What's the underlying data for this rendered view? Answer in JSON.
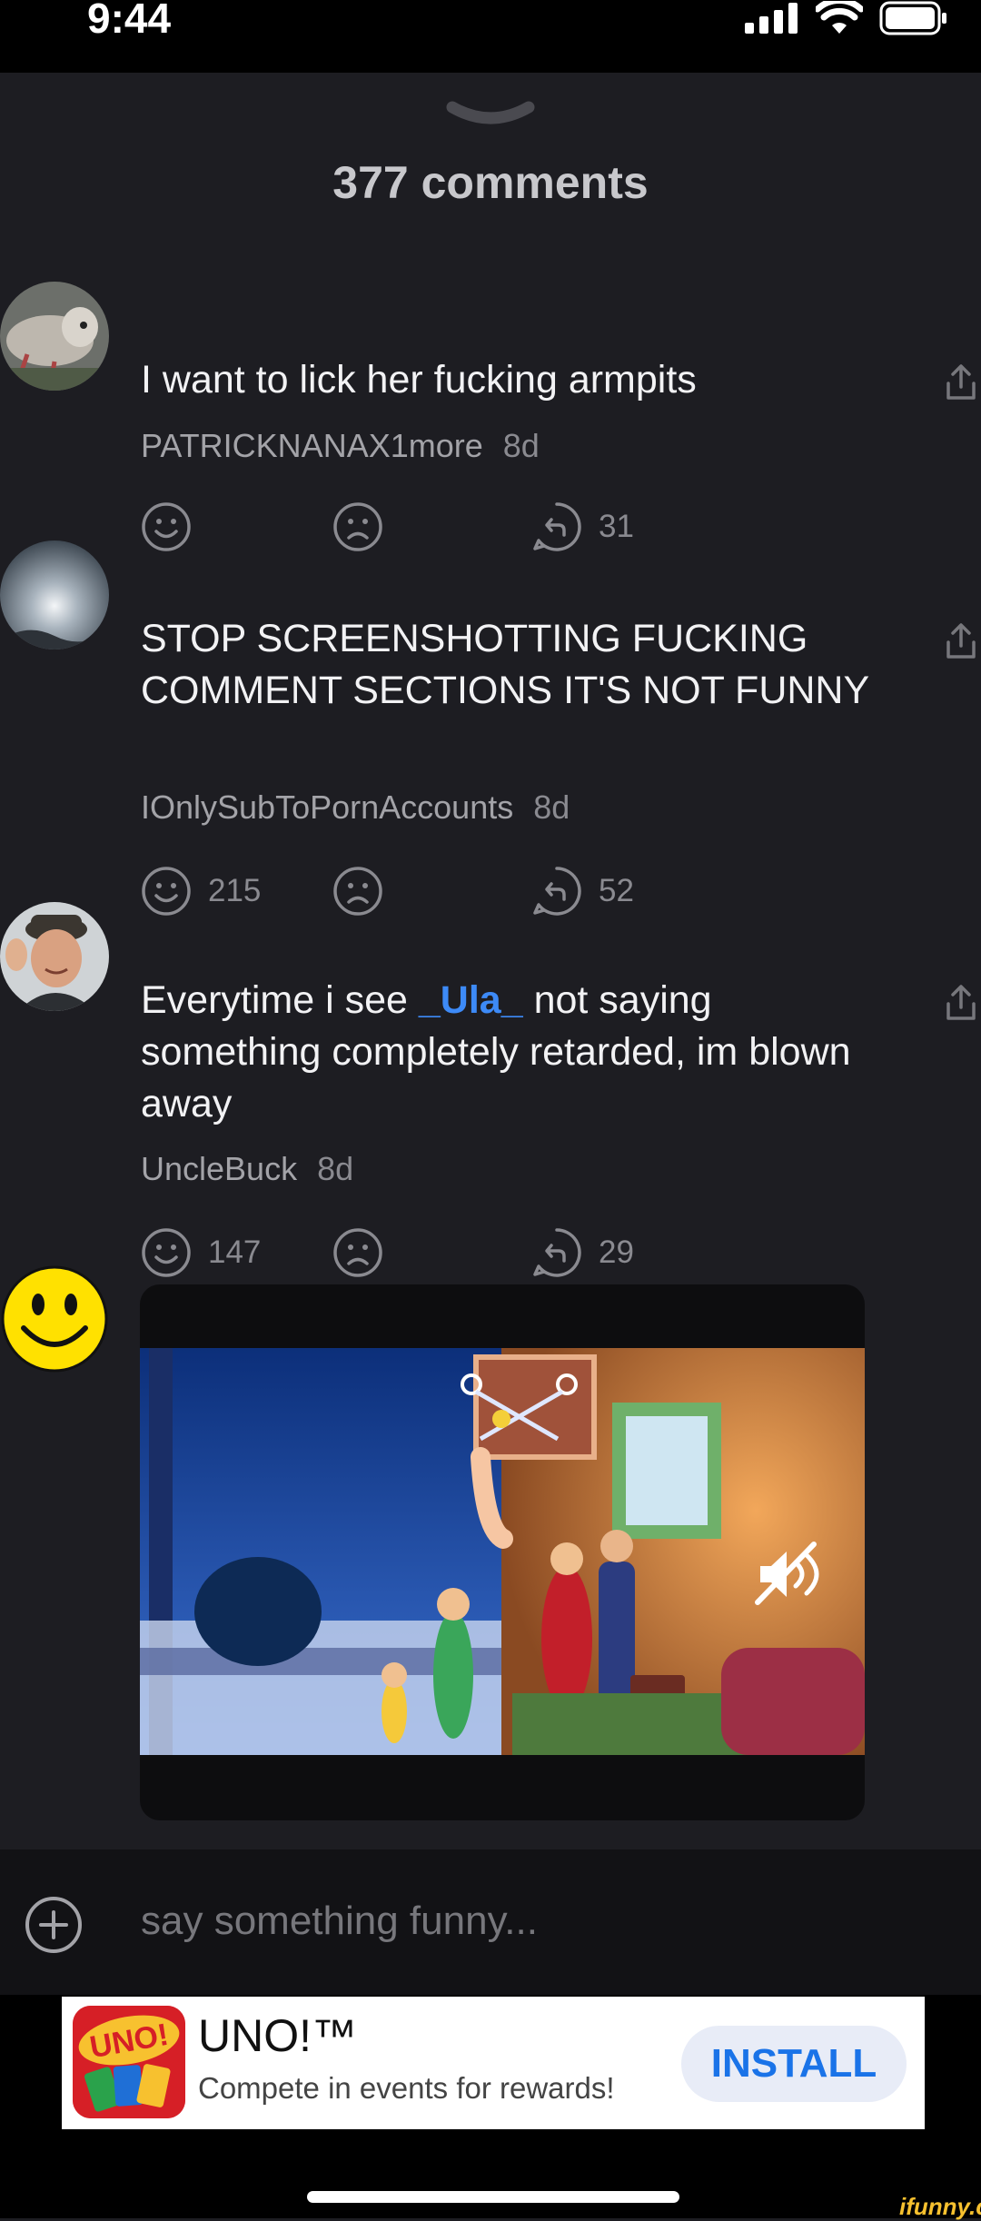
{
  "status_bar": {
    "time": "9:44"
  },
  "sheet": {
    "title": "377 comments",
    "comments": [
      {
        "text": "I want to lick her fucking armpits",
        "author": "PATRICKNANAX1more",
        "age": "8d",
        "smile_count": "",
        "reply_count": "31"
      },
      {
        "text": "STOP SCREENSHOTTING FUCKING COMMENT SECTIONS IT'S NOT FUNNY",
        "author": "IOnlySubToPornAccounts",
        "age": "8d",
        "smile_count": "215",
        "reply_count": "52"
      },
      {
        "text_before": "Everytime i see ",
        "mention": "_Ula_",
        "text_after": " not saying something completely retarded, im blown away",
        "author": "UncleBuck",
        "age": "8d",
        "smile_count": "147",
        "reply_count": "29"
      }
    ]
  },
  "input_bar": {
    "placeholder": "say something funny..."
  },
  "banner_ad": {
    "app_name": "UNO!™",
    "tagline": "Compete in events for rewards!",
    "install_label": "INSTALL",
    "logo_text": "UNO!"
  },
  "watermark": "ifunny.co",
  "colors": {
    "background": "#1d1d22",
    "mention": "#3d8af7",
    "install_text": "#1a73e8",
    "watermark": "#f7c12f"
  }
}
